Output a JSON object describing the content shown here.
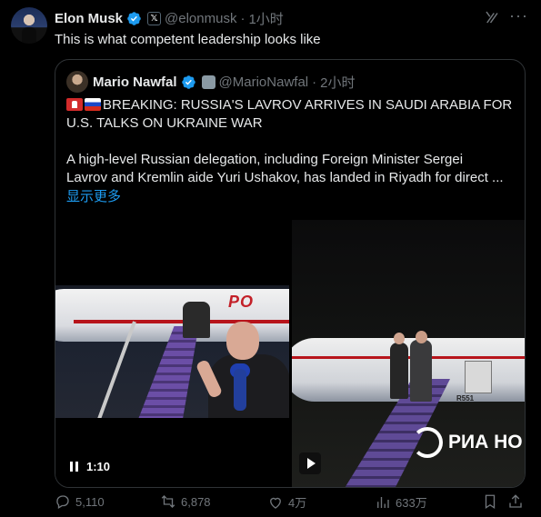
{
  "author": {
    "name": "Elon Musk",
    "x_badge": "𝕏",
    "handle": "@elonmusk",
    "time": "1小时"
  },
  "tweet_text": "This is what competent leadership looks like",
  "quote": {
    "name": "Mario Nawfal",
    "handle": "@MarioNawfal",
    "time": "2小时",
    "headline_line1": "BREAKING: RUSSIA'S LAVROV ARRIVES IN SAUDI ARABIA FOR",
    "headline_line2": "U.S. TALKS ON UKRAINE WAR",
    "body_line1": "A high-level Russian delegation, including Foreign Minister Sergei",
    "body_line2": "Lavrov and Kremlin aide Yuri Ushakov, has landed in Riyadh for direct ...",
    "show_more": "显示更多",
    "video_time": "1:10",
    "media_right_watermark": "РИА НО",
    "plane_label": "R551"
  },
  "actions": {
    "replies": "5,110",
    "reposts": "6,878",
    "likes": "4万",
    "views": "633万"
  },
  "colors": {
    "link": "#1d9bf0",
    "verified": "#1d9bf0",
    "muted": "#71767b"
  },
  "icons": [
    "verified-icon",
    "x-badge-icon",
    "grok-icon",
    "more-icon",
    "pause-icon",
    "play-icon",
    "reply-icon",
    "repost-icon",
    "like-icon",
    "views-icon",
    "bookmark-icon",
    "share-icon"
  ]
}
